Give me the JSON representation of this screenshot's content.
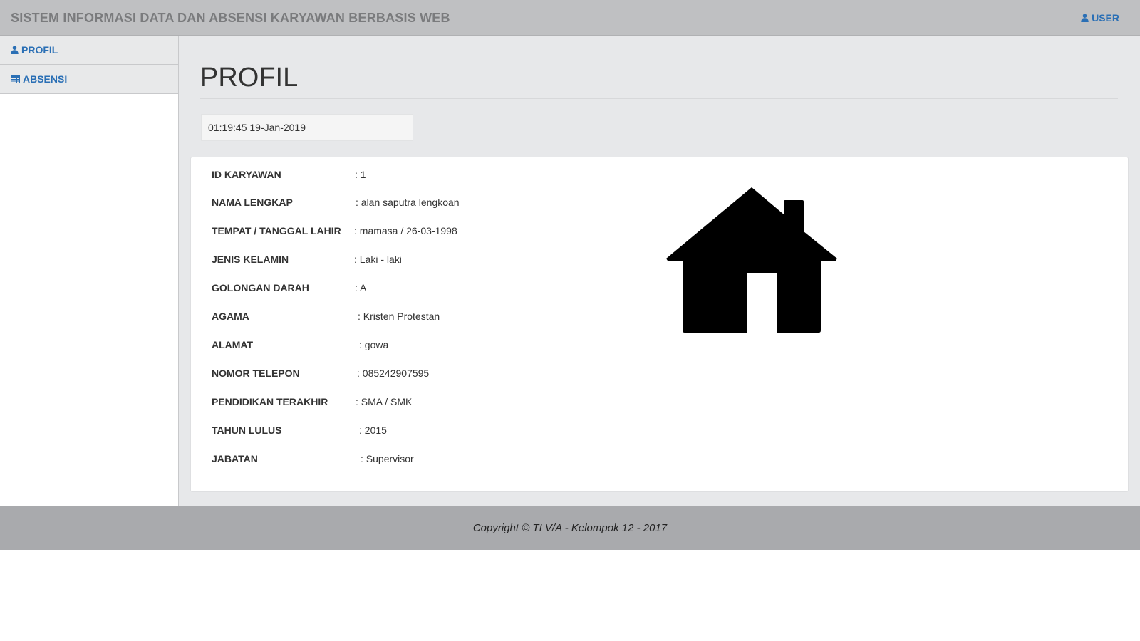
{
  "header": {
    "title": "SISTEM INFORMASI DATA DAN ABSENSI KARYAWAN BERBASIS WEB",
    "user_label": "USER"
  },
  "sidebar": {
    "items": [
      {
        "label": "PROFIL",
        "icon": "user-icon"
      },
      {
        "label": "ABSENSI",
        "icon": "table-icon"
      }
    ]
  },
  "main": {
    "page_title": "PROFIL",
    "clock": "01:19:45 19-Jan-2019",
    "profile": {
      "image_icon": "home-icon",
      "fields": [
        {
          "label": "ID KARYAWAN",
          "value": ": 1"
        },
        {
          "label": "NAMA LENGKAP",
          "value": ": alan saputra lengkoan"
        },
        {
          "label": "TEMPAT / TANGGAL LAHIR",
          "value": ": mamasa / 26-03-1998"
        },
        {
          "label": "JENIS KELAMIN",
          "value": ": Laki - laki"
        },
        {
          "label": "GOLONGAN DARAH",
          "value": ": A"
        },
        {
          "label": "AGAMA",
          "value": ": Kristen Protestan"
        },
        {
          "label": "ALAMAT",
          "value": ": gowa"
        },
        {
          "label": "NOMOR TELEPON",
          "value": ": 085242907595"
        },
        {
          "label": "PENDIDIKAN TERAKHIR",
          "value": ": SMA / SMK"
        },
        {
          "label": "TAHUN LULUS",
          "value": ": 2015"
        },
        {
          "label": "JABATAN",
          "value": ": Supervisor"
        }
      ]
    }
  },
  "footer": {
    "copyright": "Copyright © TI V/A - Kelompok 12 - 2017"
  },
  "colors": {
    "accent": "#2a6fb5",
    "topbar": "#bfc0c2",
    "footer": "#a9aaad",
    "content_bg": "#e7e8ea"
  }
}
